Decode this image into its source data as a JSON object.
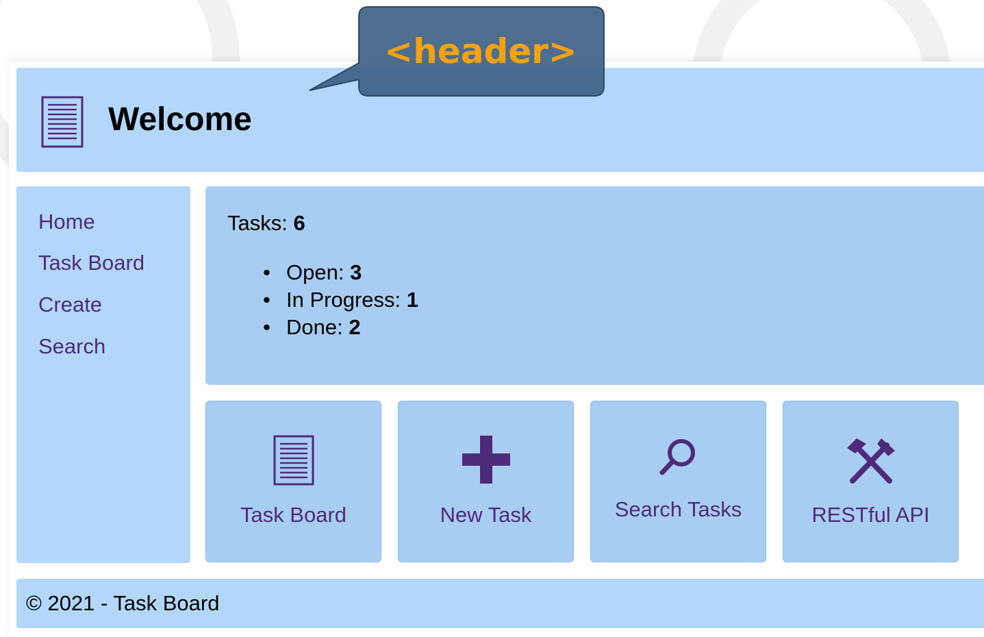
{
  "colors": {
    "header_bg": "#b3d7fb",
    "panel_bg": "#a8cdf2",
    "link": "#4f2a7a",
    "icon": "#4f2a7a",
    "callout_bg": "#3e6286",
    "callout_text": "#f6a20e"
  },
  "callout": {
    "text": "<header>"
  },
  "header": {
    "title": "Welcome",
    "logo_icon": "document-list-icon"
  },
  "nav": {
    "items": [
      {
        "label": "Home"
      },
      {
        "label": "Task Board"
      },
      {
        "label": "Create"
      },
      {
        "label": "Search"
      }
    ]
  },
  "stats": {
    "tasks_label": "Tasks:",
    "tasks_count": "6",
    "items": [
      {
        "label": "Open:",
        "value": "3"
      },
      {
        "label": "In Progress:",
        "value": "1"
      },
      {
        "label": "Done:",
        "value": "2"
      }
    ]
  },
  "tiles": [
    {
      "label": "Task Board",
      "icon": "document-list-icon"
    },
    {
      "label": "New Task",
      "icon": "plus-icon"
    },
    {
      "label": "Search Tasks",
      "icon": "search-icon"
    },
    {
      "label": "RESTful API",
      "icon": "hammer-pick-icon"
    }
  ],
  "footer": {
    "text": "© 2021 - Task Board"
  }
}
